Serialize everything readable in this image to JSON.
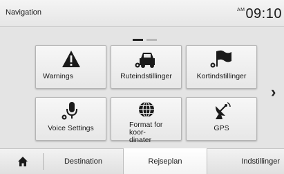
{
  "header": {
    "title": "Navigation",
    "clock_ampm": "AM",
    "clock_time": "09:10"
  },
  "pager": {
    "pages": 2,
    "current": 1
  },
  "tiles": [
    {
      "label": "Warnings",
      "icon": "warning-icon"
    },
    {
      "label": "Ruteindstillinger",
      "icon": "car-gear-icon"
    },
    {
      "label": "Kortindstillinger",
      "icon": "flag-gear-icon"
    },
    {
      "label": "Voice Settings",
      "icon": "microphone-gear-icon"
    },
    {
      "label": "Format for koor-\ndinater",
      "icon": "globe-icon"
    },
    {
      "label": "GPS",
      "icon": "satellite-dish-icon"
    }
  ],
  "next_icon": "chevron-right-icon",
  "bottom_tabs": {
    "home_icon": "home-icon",
    "items": [
      {
        "label": "Destination",
        "active": false
      },
      {
        "label": "Rejseplan",
        "active": true
      },
      {
        "label": "Indstillinger",
        "active": false
      }
    ]
  }
}
